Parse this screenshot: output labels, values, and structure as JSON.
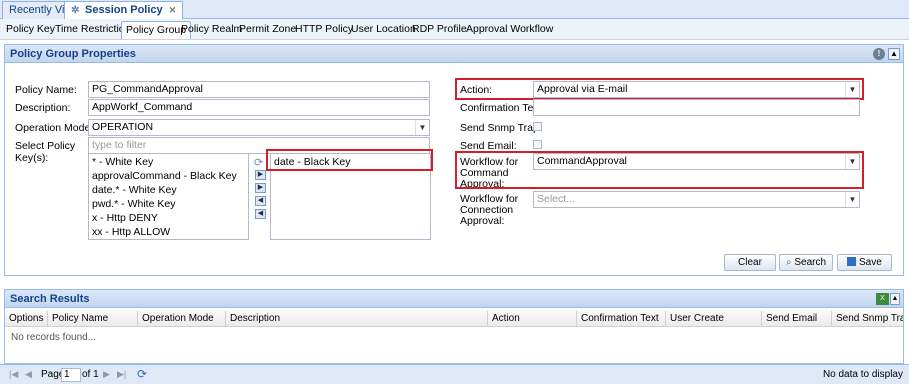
{
  "tabs": [
    {
      "label": "Recently View",
      "active": false
    },
    {
      "label": "Session Policy",
      "active": true
    }
  ],
  "subtabs": [
    "Policy Key",
    "Time Restriction",
    "Policy Group",
    "Policy Realm",
    "Permit Zone",
    "HTTP Policy",
    "User Location",
    "RDP Profile",
    "Approval Workflow"
  ],
  "active_subtab": "Policy Group",
  "form": {
    "title": "Policy Group Properties",
    "policy_name_label": "Policy Name:",
    "policy_name_value": "PG_CommandApproval",
    "description_label": "Description:",
    "description_value": "AppWorkf_Command",
    "operation_mode_label": "Operation Mode:",
    "operation_mode_value": "OPERATION",
    "select_keys_label": "Select Policy Key(s):",
    "filter_placeholder": "type to filter",
    "available_keys": [
      "* - White Key",
      "approvalCommand - Black Key",
      "date.* - White Key",
      "pwd.* - White Key",
      "x - Http DENY",
      "xx - Http ALLOW"
    ],
    "selected_keys": [
      "date - Black Key"
    ],
    "action_label": "Action:",
    "action_value": "Approval via E-mail",
    "confirmation_text_label": "Confirmation Text:",
    "confirmation_text_value": "",
    "send_snmp_label": "Send Snmp Trap:",
    "send_email_label": "Send Email:",
    "workflow_command_label_1": "Workflow for",
    "workflow_command_label_2": "Command",
    "workflow_command_label_3": "Approval:",
    "workflow_command_value": "CommandApproval",
    "workflow_connection_label_1": "Workflow for",
    "workflow_connection_label_2": "Connection",
    "workflow_connection_label_3": "Approval:",
    "workflow_connection_placeholder": "Select...",
    "clear_label": "Clear",
    "search_label": "Search",
    "save_label": "Save"
  },
  "results": {
    "title": "Search Results",
    "columns": [
      "Options",
      "Policy Name",
      "Operation Mode",
      "Description",
      "Action",
      "Confirmation Text",
      "User Create",
      "Send Email",
      "Send Snmp Trap"
    ],
    "empty_text": "No records found...",
    "page_label": "Page",
    "page_value": "1",
    "of_label": "of 1",
    "status_text": "No data to display"
  },
  "colors": {
    "highlight": "#d0202a",
    "header_text": "#15428b",
    "panel_border": "#99bbe8"
  }
}
